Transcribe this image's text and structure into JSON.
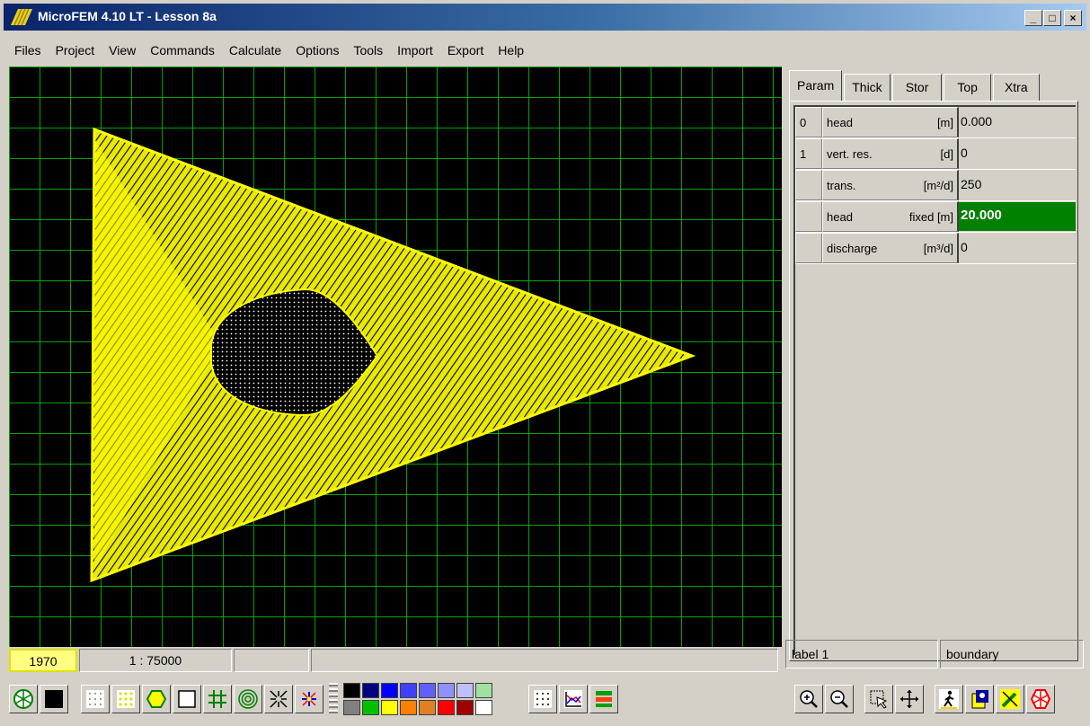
{
  "window": {
    "title": "MicroFEM 4.10 LT - Lesson 8a",
    "minimize": "_",
    "maximize": "□",
    "close": "×"
  },
  "menu": [
    "Files",
    "Project",
    "View",
    "Commands",
    "Calculate",
    "Options",
    "Tools",
    "Import",
    "Export",
    "Help"
  ],
  "status": {
    "year": "1970",
    "scale": "1 : 75000"
  },
  "panel": {
    "tabs": [
      "Param",
      "Thick",
      "Stor",
      "Top",
      "Xtra"
    ],
    "active_tab": "Param",
    "rows": [
      {
        "index": "0",
        "name": "head",
        "unit": "[m]",
        "value": "0.000"
      },
      {
        "index": "1",
        "name": "vert. res.",
        "unit": "[d]",
        "value": "0"
      },
      {
        "index": "",
        "name": "trans.",
        "unit": "[m²/d]",
        "value": "250"
      },
      {
        "index": "",
        "name": "head",
        "unit": "fixed [m]",
        "value": "20.000"
      },
      {
        "index": "",
        "name": "discharge",
        "unit": "[m³/d]",
        "value": "0"
      }
    ],
    "selected_row": 3,
    "label": "label 1",
    "label_type": "boundary"
  },
  "colors": {
    "mesh": "#ffff00",
    "grid": "#00b400",
    "selected_value_bg": "#008000",
    "year_bg": "#ffff80"
  },
  "palette": [
    "#000000",
    "#000080",
    "#0000ff",
    "#4040ff",
    "#6060ff",
    "#9090ff",
    "#c0c0ff",
    "#a0e0a0",
    "#808080",
    "#00c000",
    "#ffff00",
    "#ff8000",
    "#e08020",
    "#ff0000",
    "#a00000",
    "#ffffff"
  ],
  "toolbar_left_icons": [
    "mesh-wheel-icon",
    "color-fill-icon",
    "dot-grid-icon",
    "yellow-dots-icon",
    "hexagon-icon",
    "rectangle-icon",
    "hash-grid-icon",
    "contour-icon",
    "arrows-in-icon",
    "flow-icon"
  ],
  "toolbar_mid_icons": [
    "points-icon",
    "chart-icon",
    "layers-icon"
  ],
  "toolbar_right_icons": [
    "zoom-in-icon",
    "zoom-out-icon",
    "select-region-icon",
    "pan-icon",
    "walk-icon",
    "identify-icon",
    "pencil-icon",
    "wheel-icon"
  ]
}
